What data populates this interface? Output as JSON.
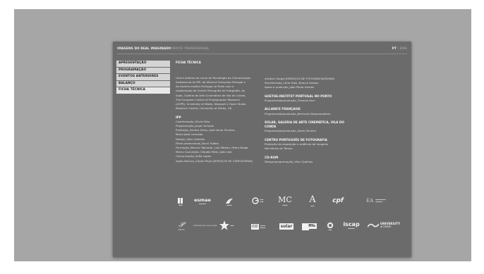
{
  "header": {
    "title": "IMAGENS DO REAL IMAGINADO",
    "subtitle": "NOITE TRANSVERSAL",
    "lang_active": "PT",
    "lang_other": "ENG"
  },
  "nav": {
    "items": [
      {
        "label": "APRESENTAÇÃO"
      },
      {
        "label": "PROGRAMAÇÃO"
      },
      {
        "label": "EVENTOS ANTERIORES"
      },
      {
        "label": "BALANÇO"
      },
      {
        "label": "FICHA TÉCNICA"
      }
    ]
  },
  "content": {
    "title": "FICHA TÉCNICA",
    "intro": [
      "Uma iniciativa do curso de Tecnologia da Comunicação",
      "Audiovisual do IPP, da Alliance Française Portugal e",
      "do Goethe-Institut Portugal no Porto com a",
      "colaboração do Centro Português de Fotografia, da",
      "Solar, Galeria de Arte Cinemática de Vila do Conde,",
      "The European Centre of Photographic Research",
      "(eCPR), University of Wales, Newport e Open Studio",
      "Research Centre, University of Derby, UK."
    ],
    "ipp_heading": "IPP",
    "ipp": [
      "Coordenação_Olívia Silva",
      "Programação_Jorge Campos",
      "Produção_Sandra Alves, José Santa Ferreira,",
      "Maria João Cortesão",
      "Design_Vítor Quelhas",
      "Filme promocional_Nuno Tudela",
      "Formação_Manuel Tabuada, Luís Ribeiro, Pedro Noiga,",
      "Marco Conceição, Cláudio Melo, João Leal",
      "Comunicação_Sofia Lopes",
      "Apoio técnico_Carlos Filipe [SERVIÇOS DE VÍDEO/ESMAE]"
    ],
    "col2_top": [
      "António Gorgal [SERVIÇOS DE FOTOGRAFIA/ESMAE]",
      "Secretariado_Carla Dias, Branca Santos",
      "Apoio à produção_João Paulo Gomes"
    ],
    "sections": [
      {
        "heading": "GOETHE-INSTITUT PORTUGAL NO PORTO",
        "lines": [
          "Programação/produção_Thomas Kern"
        ]
      },
      {
        "heading": "ALLIANCE FRANÇAISE",
        "lines": [
          "Programação/produção_Bertrand Desprosadéres"
        ]
      },
      {
        "heading": "SOLAR, GALERIA DE ARTE CINEMÁTICA, VILA DO CONDE",
        "lines": [
          "Programação/produção_Dario Oliveira"
        ]
      },
      {
        "heading": "CENTRO PORTUGUÊS DE FOTOGRAFIA",
        "lines": [
          "Produção da exposição e cedência de imagens",
          "Narrativas do Tempo"
        ]
      },
      {
        "heading": "CD-ROM",
        "lines": [
          "Design/programação_Vítor Quelhas"
        ]
      }
    ]
  },
  "logos": {
    "row1": {
      "esmae": "esmae",
      "mc": "MC",
      "a": "A",
      "cpf": "cpf",
      "ea": "EA"
    },
    "row2": {
      "porto": "PORTO",
      "bib": "bibliotecas municipais",
      "solar": "solar",
      "fffo": "fffo",
      "iscap": "iscap",
      "uod_university": "UNIVERSITY",
      "uod_of": "of DERBY"
    }
  },
  "colors": {
    "backdrop": "#a6a6a6",
    "panel": "#6b6b6b",
    "nav_item": "#d4d4d4"
  }
}
